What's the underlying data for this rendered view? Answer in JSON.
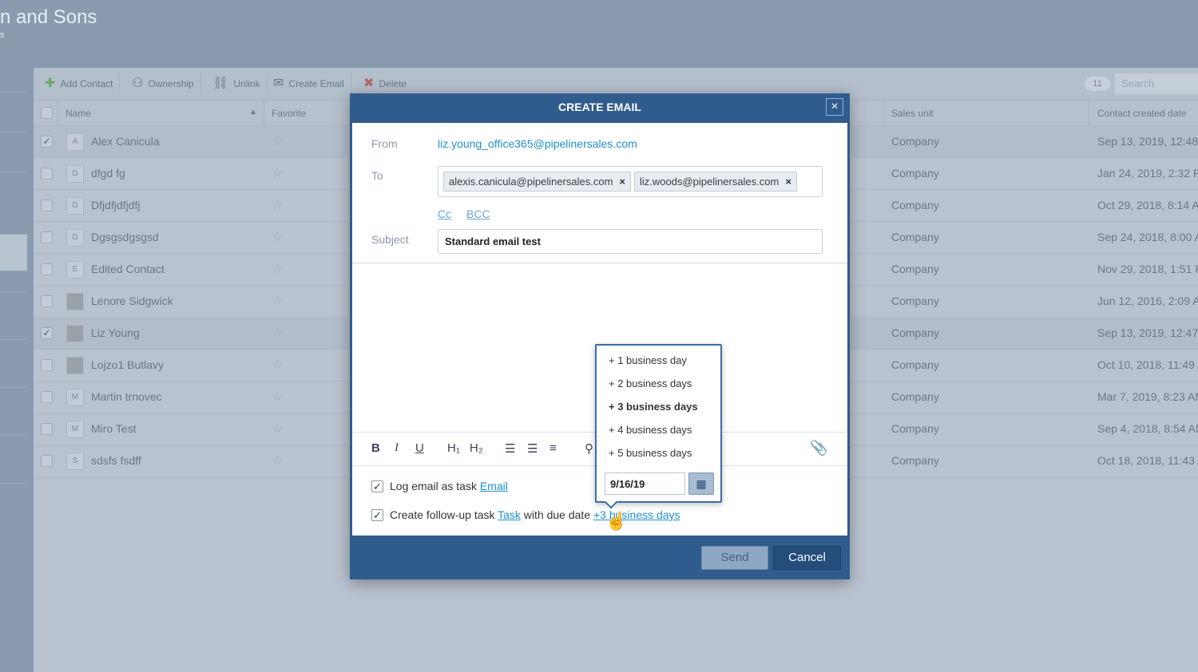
{
  "header": {
    "company_name": "n and Sons",
    "company_sub": "s"
  },
  "toolbar": {
    "add_contact": "Add Contact",
    "ownership": "Ownership",
    "unlink": "Unlink",
    "create_email": "Create Email",
    "delete": "Delete",
    "count": "11",
    "search_placeholder": "Search"
  },
  "grid": {
    "columns": {
      "name": "Name",
      "favorite": "Favorite",
      "sales_unit": "Sales unit",
      "created": "Contact created date"
    },
    "rows": [
      {
        "initial": "A",
        "name": "Alex Canicula",
        "checked": "✓",
        "unit": "Company",
        "date": "Sep 13, 2019, 12:48"
      },
      {
        "initial": "D",
        "name": "dfgd fg",
        "checked": "",
        "unit": "Company",
        "date": "Jan 24, 2019, 2:32 P"
      },
      {
        "initial": "D",
        "name": "Dfjdfjdfjdfj",
        "checked": "",
        "unit": "Company",
        "date": "Oct 29, 2018, 8:14 A"
      },
      {
        "initial": "D",
        "name": "Dgsgsdgsgsd",
        "checked": "",
        "unit": "Company",
        "date": "Sep 24, 2018, 8:00 A"
      },
      {
        "initial": "E",
        "name": "Edited Contact",
        "checked": "",
        "unit": "Company",
        "date": "Nov 29, 2018, 1:51 P"
      },
      {
        "initial": "",
        "name": "Lenore Sidgwick",
        "checked": "",
        "unit": "Company",
        "date": "Jun 12, 2016, 2:09 A"
      },
      {
        "initial": "",
        "name": "Liz Young",
        "checked": "✓",
        "unit": "Company",
        "date": "Sep 13, 2019, 12:47"
      },
      {
        "initial": "",
        "name": "Lojzo1 Butlavy",
        "checked": "",
        "unit": "Company",
        "date": "Oct 10, 2018, 11:49 A"
      },
      {
        "initial": "M",
        "name": "Martin trnovec",
        "checked": "",
        "unit": "Company",
        "date": "Mar 7, 2019, 8:23 AM"
      },
      {
        "initial": "M",
        "name": "Miro Test",
        "checked": "",
        "unit": "Company",
        "date": "Sep 4, 2018, 8:54 AM"
      },
      {
        "initial": "S",
        "name": "sdsfs fsdff",
        "checked": "",
        "unit": "Company",
        "date": "Oct 18, 2018, 11:43 A"
      }
    ]
  },
  "dialog": {
    "title": "CREATE EMAIL",
    "close": "×",
    "from_label": "From",
    "from_value": "liz.young_office365@pipelinersales.com",
    "to_label": "To",
    "to_tags": [
      "alexis.canicula@pipelinersales.com",
      "liz.woods@pipelinersales.com"
    ],
    "tag_remove": "×",
    "cc": "Cc",
    "bcc": "BCC",
    "subject_label": "Subject",
    "subject_value": "Standard email test",
    "editor": {
      "bold": "B",
      "italic": "I",
      "underline": "U",
      "h1": "H₁",
      "h2": "H₂"
    },
    "log_text": "Log email as task ",
    "log_link": "Email",
    "followup_text": "Create follow-up task ",
    "followup_link": "Task",
    "followup_mid": " with due date ",
    "followup_due": "+3 business days",
    "check": "✓",
    "send": "Send",
    "cancel": "Cancel"
  },
  "due_popup": {
    "options": [
      "+ 1 business day",
      "+ 2 business days",
      "+ 3 business days",
      "+ 4 business days",
      "+ 5 business days"
    ],
    "selected": "+ 3 business days",
    "date_value": "9/16/19"
  }
}
